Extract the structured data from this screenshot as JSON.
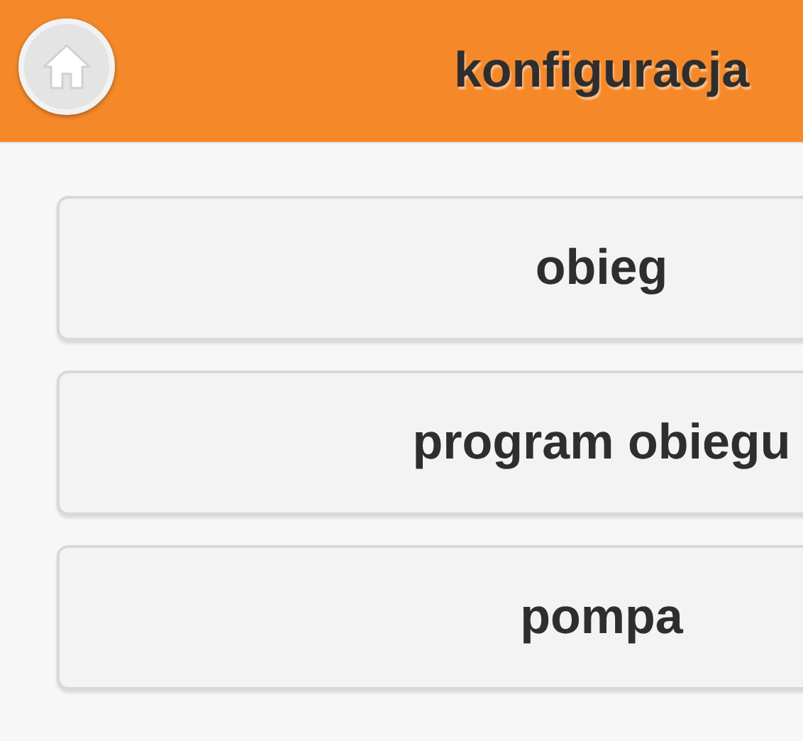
{
  "header": {
    "title": "konfiguracja"
  },
  "menu": [
    {
      "label": "obieg"
    },
    {
      "label": "program obiegu"
    },
    {
      "label": "pompa"
    }
  ]
}
